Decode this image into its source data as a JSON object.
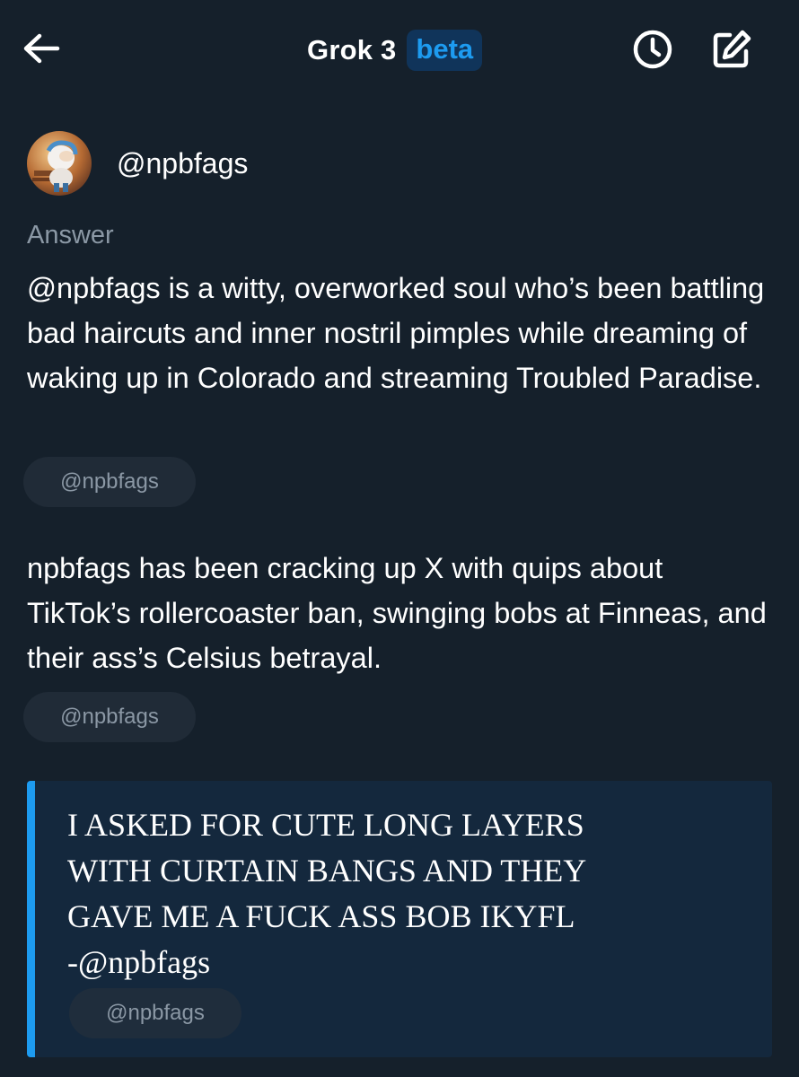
{
  "header": {
    "title": "Grok 3",
    "badge": "beta",
    "icons": {
      "back": "back-arrow-icon",
      "history": "history-clock-icon",
      "compose": "compose-edit-icon"
    }
  },
  "user": {
    "handle": "@npbfags"
  },
  "answer": {
    "label": "Answer",
    "paragraphs": [
      {
        "text": "@npbfags is a witty, overworked soul who’s been battling bad haircuts and inner nostril pimples while dreaming of waking up in Colorado and streaming Troubled Paradise.",
        "source": "@npbfags"
      },
      {
        "text": "npbfags has been cracking up X with quips about TikTok’s rollercoaster ban, swinging bobs at Finneas, and their ass’s Celsius betrayal.",
        "source": "@npbfags"
      }
    ],
    "quote": {
      "lines": [
        "I ASKED FOR CUTE LONG LAYERS",
        "WITH CURTAIN BANGS AND THEY",
        "GAVE ME A FUCK ASS BOB IKYFL",
        "-@npbfags"
      ],
      "source": "@npbfags"
    }
  },
  "colors": {
    "background": "#15202b",
    "accent": "#1d9bf0",
    "muted_text": "#8b98a5",
    "chip_bg": "#202b37",
    "quote_bg": "#14283d",
    "badge_bg": "#10345a"
  }
}
